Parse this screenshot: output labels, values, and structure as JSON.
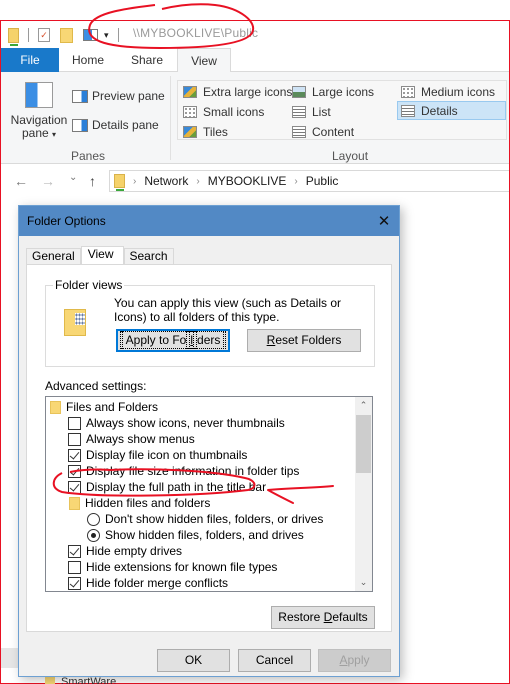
{
  "window": {
    "title_path": "\\\\MYBOOKLIVE\\Public",
    "quick_access": [
      "network-folder-icon",
      "properties-icon",
      "new-folder-icon",
      "navigation-pane-icon",
      "customize-dropdown-icon"
    ]
  },
  "ribbon": {
    "tabs": [
      {
        "label": "File",
        "active": false
      },
      {
        "label": "Home",
        "active": false
      },
      {
        "label": "Share",
        "active": false
      },
      {
        "label": "View",
        "active": true
      }
    ],
    "panes": {
      "group_label": "Panes",
      "navigation_pane_line1": "Navigation",
      "navigation_pane_line2": "pane",
      "preview_pane": "Preview pane",
      "details_pane": "Details pane"
    },
    "layout": {
      "group_label": "Layout",
      "items": [
        {
          "label": "Extra large icons",
          "selected": false
        },
        {
          "label": "Large icons",
          "selected": false
        },
        {
          "label": "Medium icons",
          "selected": false
        },
        {
          "label": "Small icons",
          "selected": false
        },
        {
          "label": "List",
          "selected": false
        },
        {
          "label": "Details",
          "selected": true
        },
        {
          "label": "Tiles",
          "selected": false
        },
        {
          "label": "Content",
          "selected": false
        }
      ]
    }
  },
  "address_bar": {
    "back": "←",
    "forward": "→",
    "recent": "⌄",
    "up": "↑",
    "breadcrumbs": [
      "Network",
      "MYBOOKLIVE",
      "Public"
    ],
    "separator": "›"
  },
  "background": {
    "list_item_partial": "SmartWare"
  },
  "dialog": {
    "title": "Folder Options",
    "close": "✕",
    "tabs": [
      {
        "label": "General",
        "active": false
      },
      {
        "label": "View",
        "active": true
      },
      {
        "label": "Search",
        "active": false
      }
    ],
    "folder_views": {
      "legend": "Folder views",
      "description": "You can apply this view (such as Details or Icons) to all folders of this type.",
      "apply_button_pre": "Apply to Fo",
      "apply_button_ul": "l",
      "apply_button_post": "ders",
      "reset_button_ul": "R",
      "reset_button_post": "eset Folders"
    },
    "advanced_label": "Advanced settings:",
    "advanced_items": [
      {
        "type": "folder",
        "label": "Files and Folders",
        "level": 0
      },
      {
        "type": "checkbox",
        "label": "Always show icons, never thumbnails",
        "checked": false,
        "level": 1
      },
      {
        "type": "checkbox",
        "label": "Always show menus",
        "checked": false,
        "level": 1
      },
      {
        "type": "checkbox",
        "label": "Display file icon on thumbnails",
        "checked": true,
        "level": 1
      },
      {
        "type": "checkbox",
        "label": "Display file size information in folder tips",
        "checked": true,
        "level": 1
      },
      {
        "type": "checkbox",
        "label": "Display the full path in the title bar",
        "checked": true,
        "level": 1
      },
      {
        "type": "folder",
        "label": "Hidden files and folders",
        "level": 1
      },
      {
        "type": "radio",
        "label": "Don't show hidden files, folders, or drives",
        "checked": false,
        "level": 2
      },
      {
        "type": "radio",
        "label": "Show hidden files, folders, and drives",
        "checked": true,
        "level": 2
      },
      {
        "type": "checkbox",
        "label": "Hide empty drives",
        "checked": true,
        "level": 1
      },
      {
        "type": "checkbox",
        "label": "Hide extensions for known file types",
        "checked": false,
        "level": 1
      },
      {
        "type": "checkbox",
        "label": "Hide folder merge conflicts",
        "checked": true,
        "level": 1
      }
    ],
    "restore_pre": "Restore ",
    "restore_ul": "D",
    "restore_post": "efaults",
    "ok": "OK",
    "cancel": "Cancel",
    "apply_ul": "A",
    "apply_post": "pply",
    "scroll_up": "⌃",
    "scroll_down": "⌄"
  },
  "colors": {
    "accent": "#1979ca",
    "dialog_title": "#5289c5",
    "annotation": "#e81123",
    "selected_layout": "#cce4f7"
  }
}
